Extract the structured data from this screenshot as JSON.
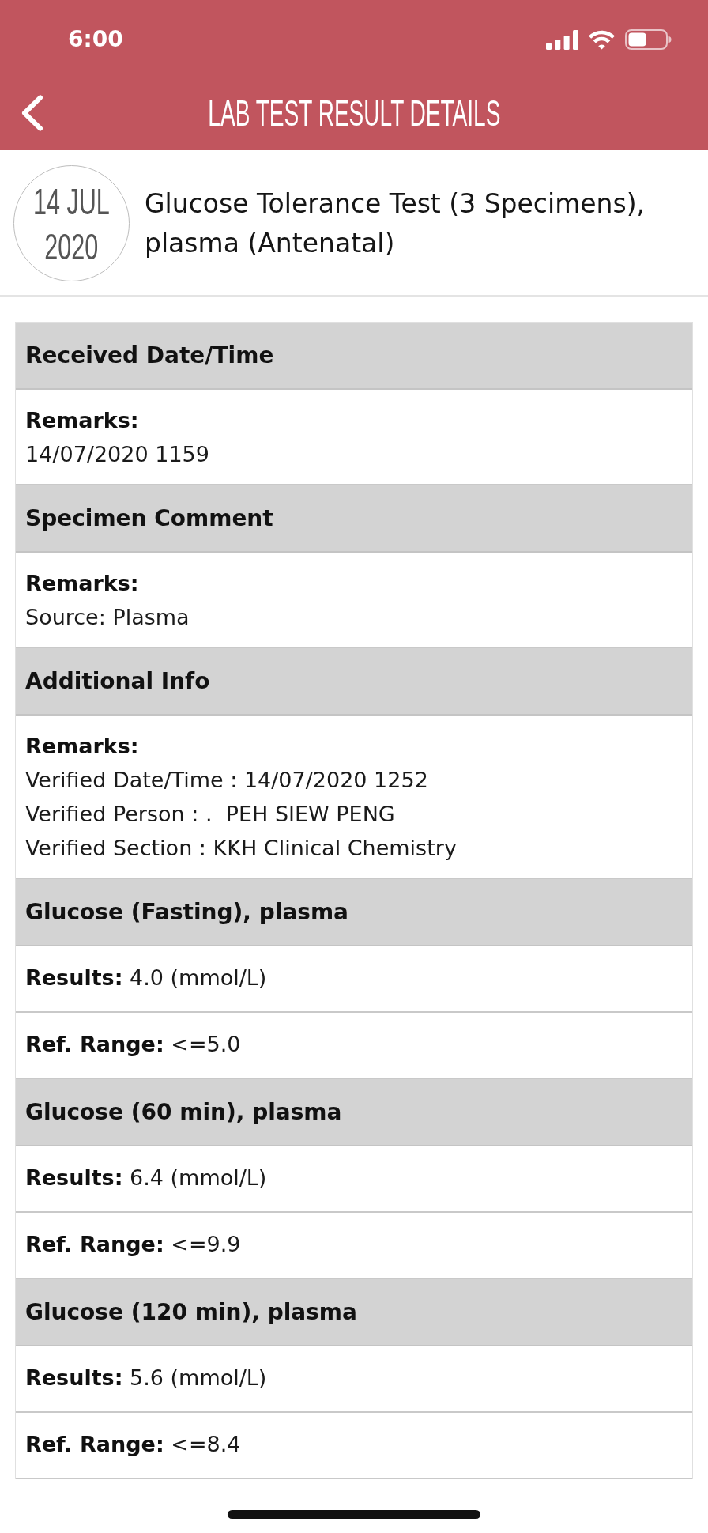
{
  "status_bar": {
    "time": "6:00"
  },
  "nav_bar": {
    "title": "LAB TEST RESULT DETAILS"
  },
  "test_header": {
    "date_day_month": "14 JUL",
    "date_year": "2020",
    "title": "Glucose Tolerance Test (3 Specimens), plasma (Antenatal)"
  },
  "sections": [
    {
      "heading": "Received Date/Time",
      "rows": [
        {
          "kind": "remarks",
          "label": "Remarks:",
          "lines": [
            "14/07/2020 1159"
          ]
        }
      ]
    },
    {
      "heading": "Specimen Comment",
      "rows": [
        {
          "kind": "remarks",
          "label": "Remarks:",
          "lines": [
            "Source: Plasma"
          ]
        }
      ]
    },
    {
      "heading": "Additional Info",
      "rows": [
        {
          "kind": "remarks",
          "label": "Remarks:",
          "lines": [
            "Verified Date/Time : 14/07/2020 1252",
            "Verified Person : .  PEH SIEW PENG",
            "Verified Section : KKH Clinical Chemistry"
          ]
        }
      ]
    },
    {
      "heading": "Glucose (Fasting), plasma",
      "rows": [
        {
          "kind": "result",
          "text": "**Results:** 4.0 (mmol/L)"
        },
        {
          "kind": "result",
          "text": "**Ref. Range:** <=5.0"
        }
      ]
    },
    {
      "heading": "Glucose (60 min), plasma",
      "rows": [
        {
          "kind": "result",
          "text": "**Results:** 6.4 (mmol/L)"
        },
        {
          "kind": "result",
          "text": "**Ref. Range:** <=9.9"
        }
      ]
    },
    {
      "heading": "Glucose (120 min), plasma",
      "rows": [
        {
          "kind": "result",
          "text": "**Results:** 5.6 (mmol/L)"
        },
        {
          "kind": "result",
          "text": "**Ref. Range:** <=8.4"
        }
      ]
    }
  ]
}
